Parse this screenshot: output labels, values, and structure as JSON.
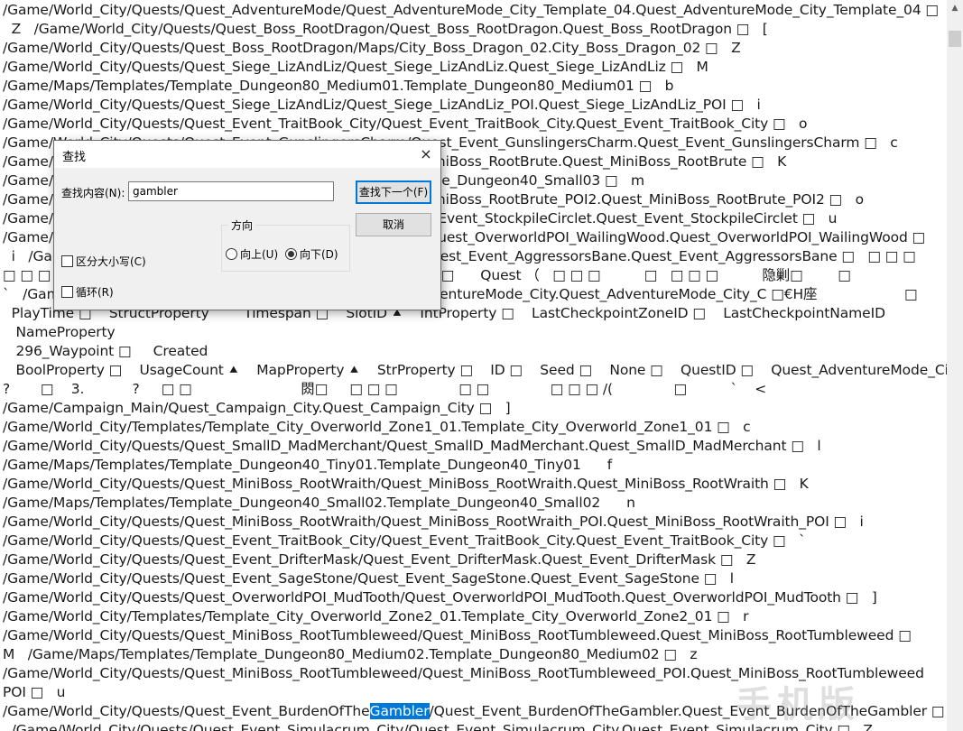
{
  "editor": {
    "lines": [
      "/Game/World_City/Quests/Quest_AdventureMode/Quest_AdventureMode_City_Template_04.Quest_AdventureMode_City_Template_04 □",
      "  Z   /Game/World_City/Quests/Quest_Boss_RootDragon/Quest_Boss_RootDragon.Quest_Boss_RootDragon □   [",
      "/Game/World_City/Quests/Quest_Boss_RootDragon/Maps/City_Boss_Dragon_02.City_Boss_Dragon_02 □   Z",
      "/Game/World_City/Quests/Quest_Siege_LizAndLiz/Quest_Siege_LizAndLiz.Quest_Siege_LizAndLiz □   M",
      "/Game/Maps/Templates/Template_Dungeon80_Medium01.Template_Dungeon80_Medium01 □   b",
      "/Game/World_City/Quests/Quest_Siege_LizAndLiz/Quest_Siege_LizAndLiz_POI.Quest_Siege_LizAndLiz_POI □   i",
      "/Game/World_City/Quests/Quest_Event_TraitBook_City/Quest_Event_TraitBook_City.Quest_Event_TraitBook_City □   o",
      "/Game/World_City/Quests/Quest_Event_GunslingersCharm/Quest_Event_GunslingersCharm.Quest_Event_GunslingersCharm □   c",
      "/Game/World_City/Quests/Quest_MiniBoss_RootBrute/Quest_MiniBoss_RootBrute.Quest_MiniBoss_RootBrute □   K",
      "/Game/Maps/Templates/Template_Dungeon40_Small03.Template_Dungeon40_Small03 □   m",
      "/Game/World_City/Quests/Quest_MiniBoss_RootBrute/Quest_MiniBoss_RootBrute_POI2.Quest_MiniBoss_RootBrute_POI2 □   o",
      "/Game/World_City/Quests/Quest_Event_StockpileCirclet/Quest_Event_StockpileCirclet.Quest_Event_StockpileCirclet □   u",
      "/Game/World_City/Quests/Quest_OverworldPOI_WailingWood/Quest_OverworldPOI_WailingWood.Quest_OverworldPOI_WailingWood □",
      "  i   /Game/World_City/Quests/Quest_Event_AggressorsBane/Quest_Event_AggressorsBane.Quest_Event_AggressorsBane □   □ □ □          □",
      "□ □ □                                    StructPlayerInventory □     □       □      Quest （   □ □ □          □   □ □ □          隐剿□        □",
      "`   /Game/World_City/Quests/Quest_AdventureMode/Quest_AdventureMode_City.Quest_AdventureMode_City_C □€H座                    □",
      "  PlayTime □    StructProperty        Timespan □    SlotID ⯅    IntProperty □    LastCheckpointZoneID □    LastCheckpointNameID",
      "   NameProperty",
      "   296_Waypoint □     Created",
      "   BoolProperty □    UsageCount ⯅    MapProperty ⯅    StrProperty □    ID □    Seed □    None □    QuestID □    Quest_AdventureMode_City_C",
      "?       □    3.           ?     □ □                         閦□     □ □ □              □ □              □ □ □ /(              □          `    <",
      "/Game/Campaign_Main/Quest_Campaign_City.Quest_Campaign_City □   ]",
      "/Game/World_City/Templates/Template_City_Overworld_Zone1_01.Template_City_Overworld_Zone1_01 □   c",
      "/Game/World_City/Quests/Quest_SmallD_MadMerchant/Quest_SmallD_MadMerchant.Quest_SmallD_MadMerchant □   l",
      "/Game/Maps/Templates/Template_Dungeon40_Tiny01.Template_Dungeon40_Tiny01      f",
      "/Game/World_City/Quests/Quest_MiniBoss_RootWraith/Quest_MiniBoss_RootWraith.Quest_MiniBoss_RootWraith □   K",
      "/Game/Maps/Templates/Template_Dungeon40_Small02.Template_Dungeon40_Small02      n",
      "/Game/World_City/Quests/Quest_MiniBoss_RootWraith/Quest_MiniBoss_RootWraith_POI.Quest_MiniBoss_RootWraith_POI □   i",
      "/Game/World_City/Quests/Quest_Event_TraitBook_City/Quest_Event_TraitBook_City.Quest_Event_TraitBook_City □   `",
      "/Game/World_City/Quests/Quest_Event_DrifterMask/Quest_Event_DrifterMask.Quest_Event_DrifterMask □   Z",
      "/Game/World_City/Quests/Quest_Event_SageStone/Quest_Event_SageStone.Quest_Event_SageStone □   l",
      "/Game/World_City/Quests/Quest_OverworldPOI_MudTooth/Quest_OverworldPOI_MudTooth.Quest_OverworldPOI_MudTooth □   ]",
      "/Game/World_City/Templates/Template_City_Overworld_Zone2_01.Template_City_Overworld_Zone2_01 □   r",
      "/Game/World_City/Quests/Quest_MiniBoss_RootTumbleweed/Quest_MiniBoss_RootTumbleweed.Quest_MiniBoss_RootTumbleweed □",
      "M   /Game/Maps/Templates/Template_Dungeon80_Medium02.Template_Dungeon80_Medium02 □   z",
      "/Game/World_City/Quests/Quest_MiniBoss_RootTumbleweed/Quest_MiniBoss_RootTumbleweed_POI.Quest_MiniBoss_RootTumbleweed",
      "POI □   u"
    ],
    "match_line": {
      "before": "/Game/World_City/Quests/Quest_Event_BurdenOfThe",
      "match": "Gambler",
      "after": "/Quest_Event_BurdenOfTheGambler.Quest_Event_BurdenOfTheGambler □"
    },
    "last_line": "  /Game/World_City/Quests/Quest_Event_Simulacrum_City/Quest_Event_Simulacrum_City.Quest_Event_Simulacrum_City □   Z"
  },
  "find_dialog": {
    "title": "查找",
    "close_icon": "×",
    "find_label": "查找内容(N):",
    "find_value": "gambler",
    "find_next_button": "查找下一个(F)",
    "cancel_button": "取消",
    "direction_label": "方向",
    "direction_up": "向上(U)",
    "direction_down": "向下(D)",
    "direction_selected": "down",
    "match_case_label": "区分大小写(C)",
    "wrap_label": "循环(R)"
  },
  "watermark": "手机版"
}
